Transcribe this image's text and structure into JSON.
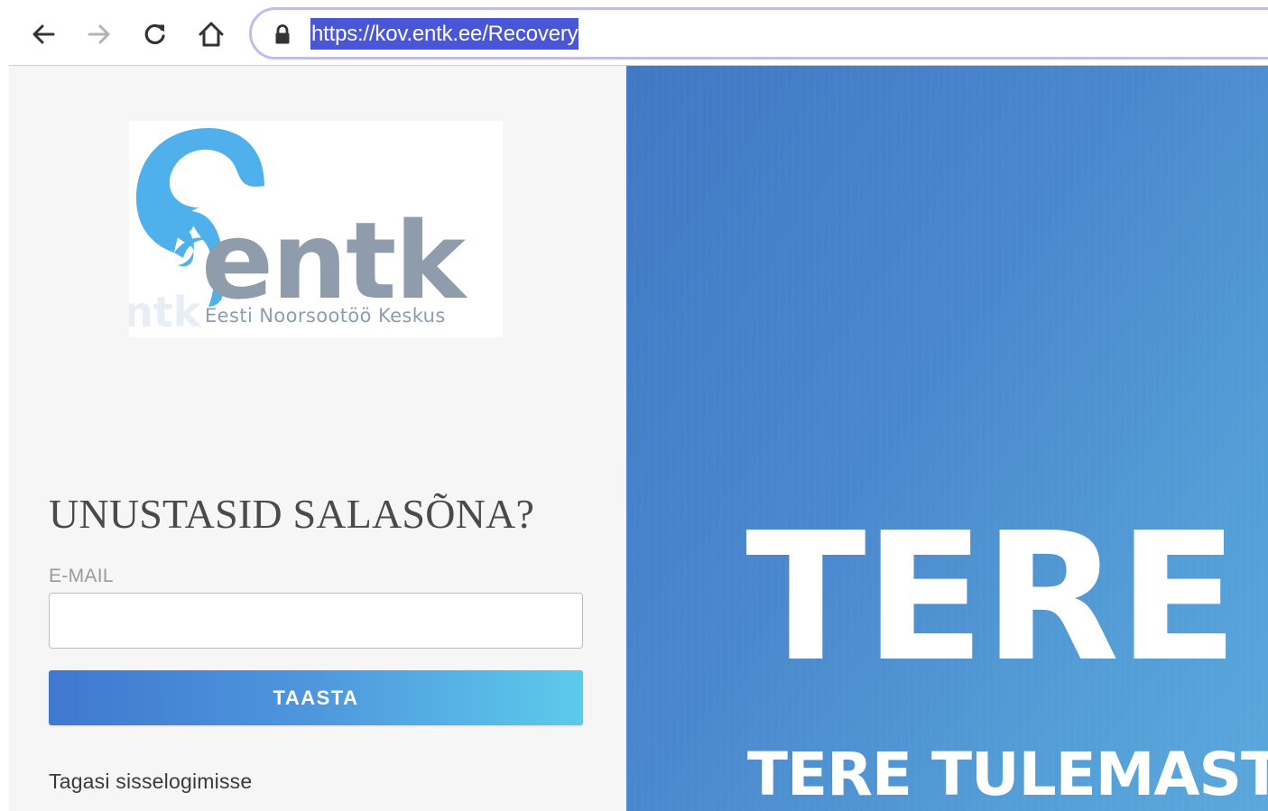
{
  "browser": {
    "url": "https://kov.entk.ee/Recovery",
    "icons": {
      "back": "arrow-left-icon",
      "forward": "arrow-right-icon",
      "reload": "reload-icon",
      "home": "home-icon",
      "secure": "lock-icon"
    }
  },
  "logo": {
    "wordmark": "entk",
    "subtitle": "Eesti Noorsootöö Keskus",
    "colors": {
      "swirl": "#4fb0ec",
      "text": "#8e9cab"
    }
  },
  "form": {
    "title": "UNUSTASID SALASÕNA?",
    "email_label": "E-MAIL",
    "email_value": "",
    "submit_label": "TAASTA",
    "back_link": "Tagasi sisselogimisse"
  },
  "hero": {
    "title": "TERE T",
    "subtitle": "TERE TULEMAST"
  },
  "colors": {
    "accent_start": "#3f78cf",
    "accent_end": "#5ccbeb",
    "hero_bg": "#4a88cd",
    "panel_bg": "#f6f6f6",
    "url_highlight": "#4a56d8"
  }
}
